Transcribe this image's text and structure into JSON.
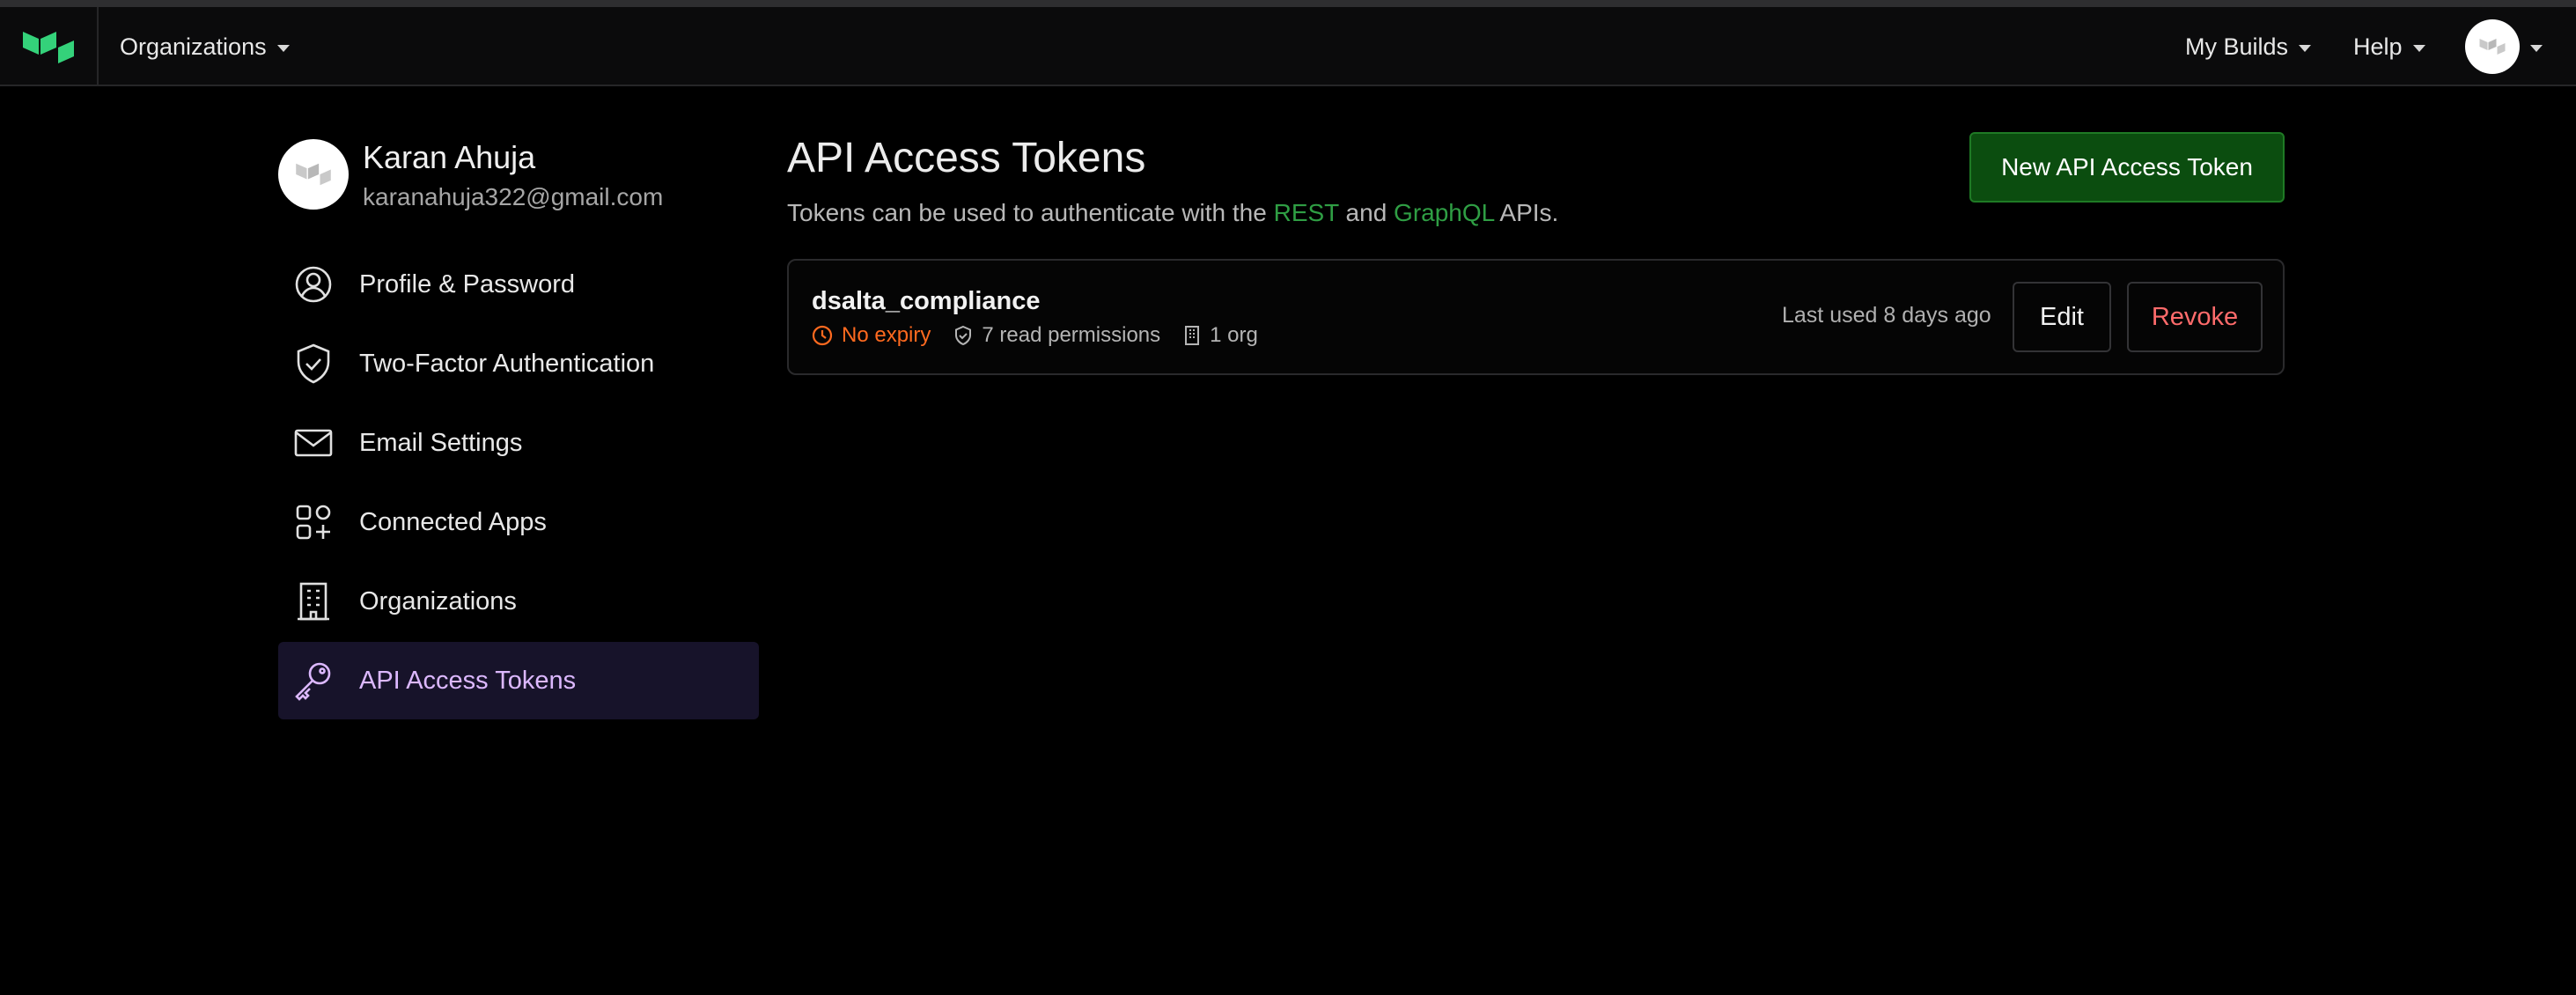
{
  "nav": {
    "organizations_label": "Organizations",
    "my_builds_label": "My Builds",
    "help_label": "Help",
    "logo_icon": "buildkite-logo-icon",
    "brand_color": "#34d27a"
  },
  "profile": {
    "name": "Karan Ahuja",
    "email": "karanahuja322@gmail.com"
  },
  "sidebar": {
    "items": [
      {
        "label": "Profile & Password",
        "icon": "user-circle-icon"
      },
      {
        "label": "Two-Factor Authentication",
        "icon": "shield-check-icon"
      },
      {
        "label": "Email Settings",
        "icon": "envelope-icon"
      },
      {
        "label": "Connected Apps",
        "icon": "apps-grid-icon"
      },
      {
        "label": "Organizations",
        "icon": "building-icon"
      },
      {
        "label": "API Access Tokens",
        "icon": "key-icon",
        "active": true
      }
    ],
    "active_color": "#dcb8ff"
  },
  "main": {
    "title": "API Access Tokens",
    "subtitle_prefix": "Tokens can be used to authenticate with the",
    "rest_link": "REST",
    "and_text": "and",
    "graphql_link": "GraphQL",
    "subtitle_suffix": "APIs.",
    "new_token_button": "New API Access Token",
    "link_color": "#2f9e44"
  },
  "tokens": [
    {
      "name": "dsalta_compliance",
      "expiry": "No expiry",
      "permissions": "7 read permissions",
      "orgs": "1 org",
      "last_used": "Last used 8 days ago",
      "edit_label": "Edit",
      "revoke_label": "Revoke"
    }
  ]
}
